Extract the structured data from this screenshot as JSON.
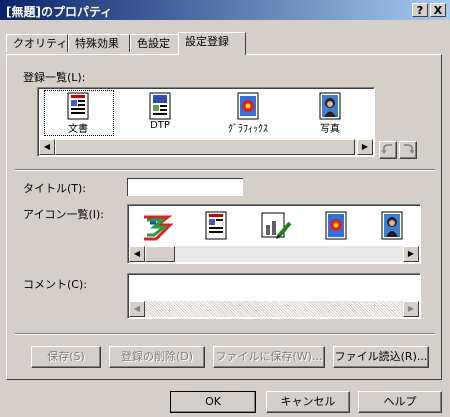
{
  "window": {
    "title": "[無題]のプロパティ",
    "help_glyph": "?",
    "close_glyph": "X"
  },
  "tabs": [
    "クオリティ",
    "特殊効果",
    "色設定",
    "設定登録"
  ],
  "active_tab": "設定登録",
  "registration_list": {
    "label": "登録一覧(L):",
    "items": [
      {
        "label": "文書",
        "icon": "document-icon"
      },
      {
        "label": "DTP",
        "icon": "dtp-icon"
      },
      {
        "label": "ｸﾞﾗﾌｨｯｸｽ",
        "icon": "graphics-icon"
      },
      {
        "label": "写真",
        "icon": "photo-icon"
      }
    ]
  },
  "title_field": {
    "label": "タイトル(T):",
    "value": ""
  },
  "icon_list": {
    "label": "アイコン一覧(I):",
    "items": [
      "rainbow-3-icon",
      "document-icon",
      "chart-pen-icon",
      "flower-icon",
      "portrait-icon"
    ]
  },
  "comment": {
    "label": "コメント(C):",
    "value": ""
  },
  "actions": {
    "save": "保存(S)",
    "delete": "登録の削除(D)",
    "save_file": "ファイルに保存(W)...",
    "load_file": "ファイル読込(R)..."
  },
  "footer": {
    "ok": "OK",
    "cancel": "キャンセル",
    "help": "ヘルプ"
  },
  "colors": {
    "titlebar_start": "#0a246a",
    "titlebar_end": "#a6caf0",
    "face": "#d4d0c8"
  }
}
